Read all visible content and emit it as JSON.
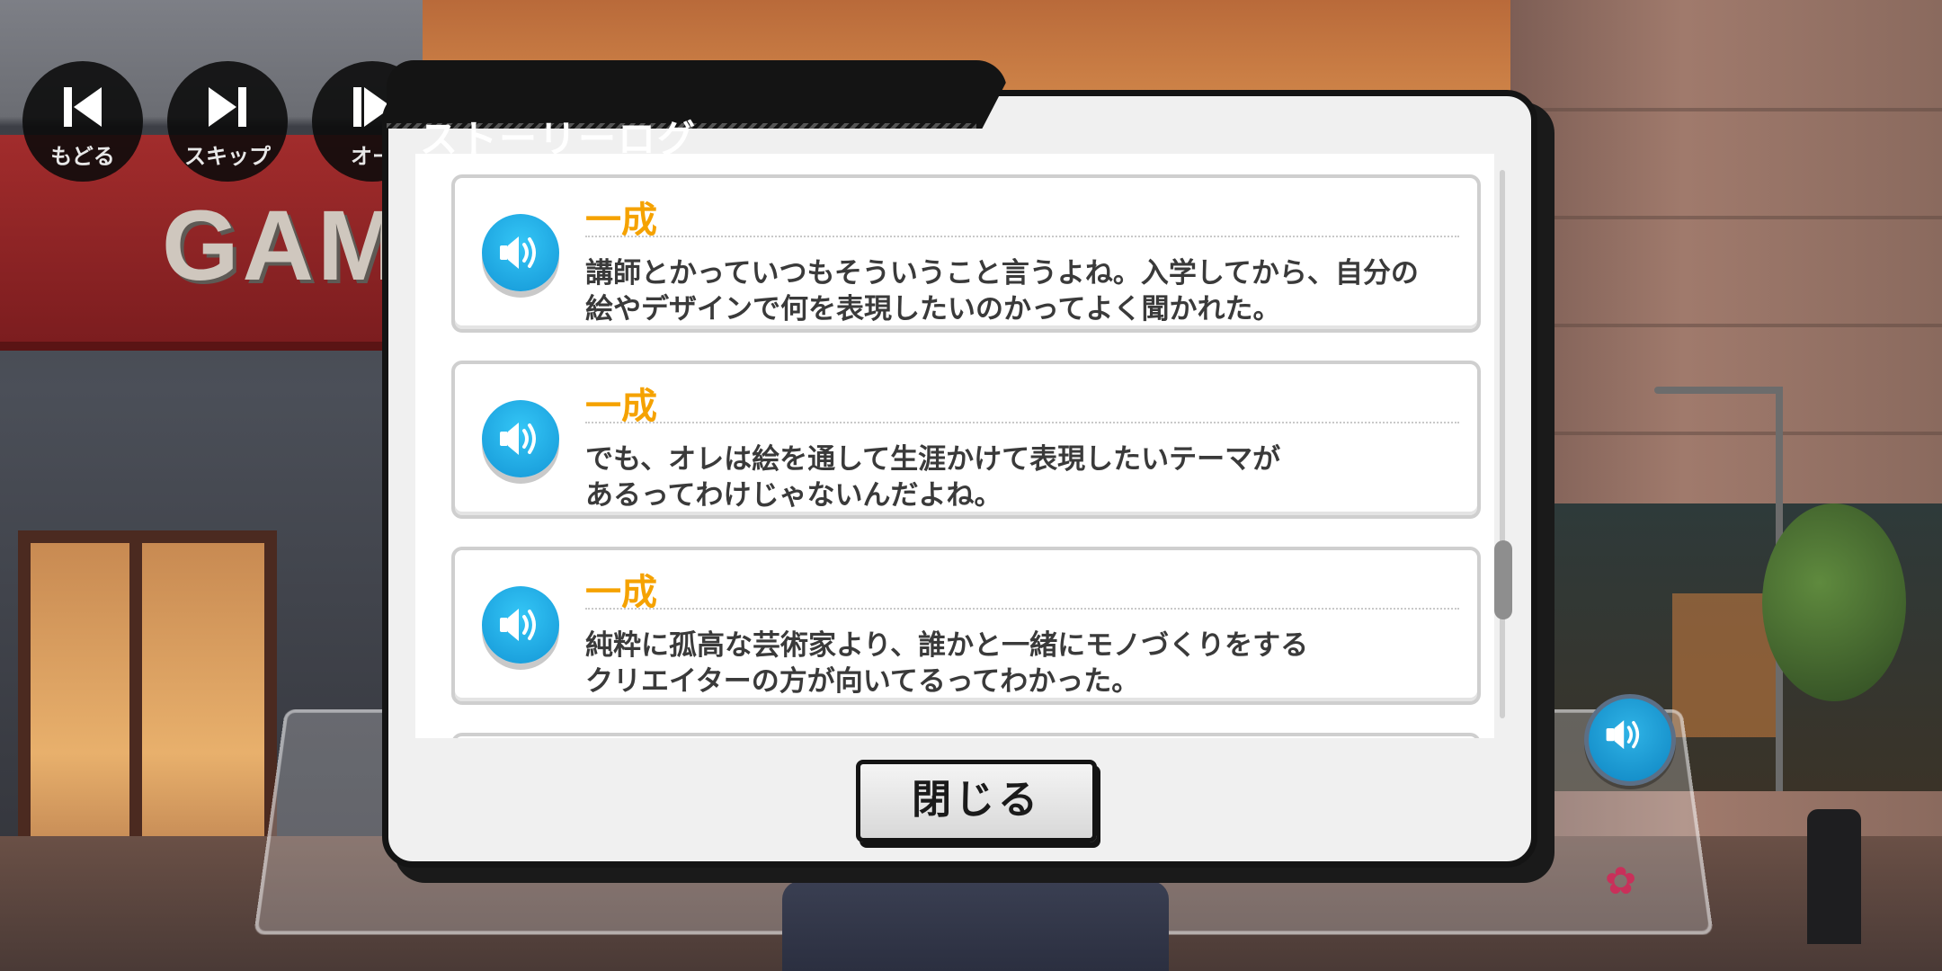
{
  "controls": {
    "back_label": "もどる",
    "skip_label": "スキップ",
    "auto_label": "オー"
  },
  "background": {
    "sign_text": "GAM"
  },
  "story_log": {
    "title": "ストーリーログ",
    "entries": [
      {
        "speaker": "一成",
        "line1": "講師とかっていつもそういうこと言うよね。入学してから、自分の",
        "line2": "絵やデザインで何を表現したいのかってよく聞かれた。"
      },
      {
        "speaker": "一成",
        "line1": "でも、オレは絵を通して生涯かけて表現したいテーマが",
        "line2": "あるってわけじゃないんだよね。"
      },
      {
        "speaker": "一成",
        "line1": "純粋に孤高な芸術家より、誰かと一緒にモノづくりをする",
        "line2": "クリエイターの方が向いてるってわかった。"
      }
    ],
    "close_label": "閉じる"
  },
  "colors": {
    "speaker_name": "#f5a200",
    "voice_button": "#1496d6",
    "dialog_border": "#141414"
  },
  "icons": {
    "back": "rewind-icon",
    "skip": "skip-forward-icon",
    "auto": "auto-play-icon",
    "voice": "speaker-volume-icon",
    "sakura": "sakura-icon"
  }
}
